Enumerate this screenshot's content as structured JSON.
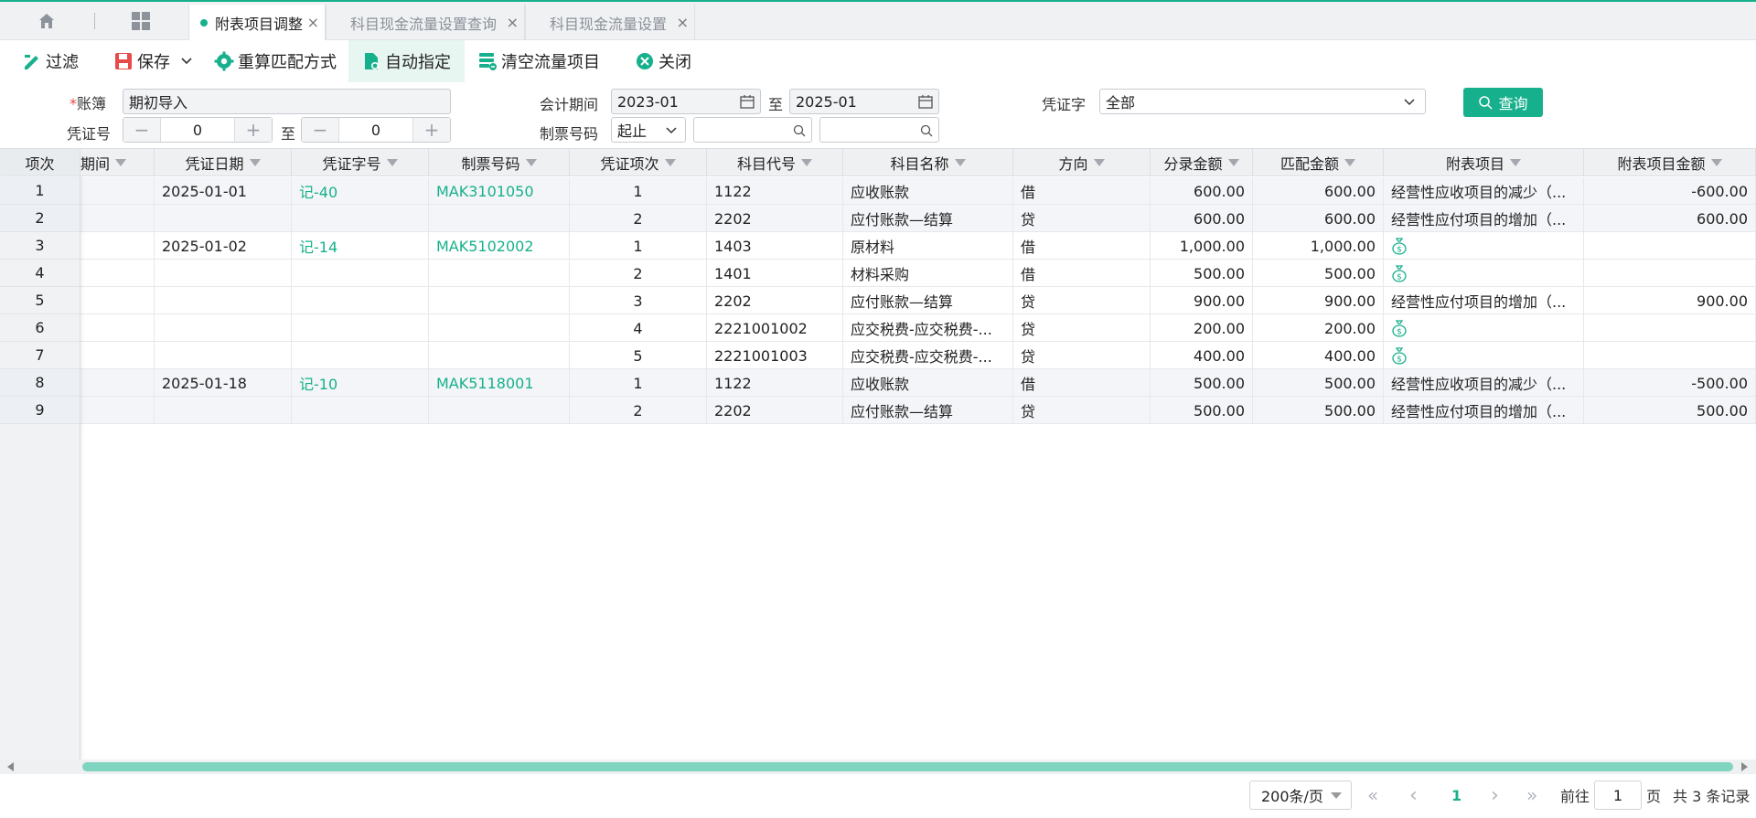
{
  "tabs": [
    {
      "label": "附表项目调整",
      "active": true
    },
    {
      "label": "科目现金流量设置查询",
      "active": false
    },
    {
      "label": "科目现金流量设置",
      "active": false
    }
  ],
  "toolbar": {
    "filter": "过滤",
    "save": "保存",
    "recalc": "重算匹配方式",
    "auto_assign": "自动指定",
    "clear_flow": "清空流量项目",
    "close": "关闭"
  },
  "filters": {
    "ledger_label": "账簿",
    "ledger_required_mark": "*",
    "ledger_value": "期初导入",
    "voucher_no_label": "凭证号",
    "voucher_no_from": "0",
    "voucher_no_to": "0",
    "to_label": "至",
    "period_label": "会计期间",
    "period_from": "2023-01",
    "period_to": "2025-01",
    "ticket_no_label": "制票号码",
    "ticket_mode": "起止",
    "ticket_from": "",
    "ticket_to": "",
    "voucher_word_label": "凭证字",
    "voucher_word_value": "全部",
    "query_button": "查询"
  },
  "grid": {
    "headers": [
      "项次",
      "期间",
      "凭证日期",
      "凭证字号",
      "制票号码",
      "凭证项次",
      "科目代号",
      "科目名称",
      "方向",
      "分录金额",
      "匹配金额",
      "附表项目",
      "附表项目金额"
    ],
    "rows": [
      {
        "idx": "1",
        "date": "2025-01-01",
        "word": "记-40",
        "ticket": "MAK3101050",
        "seq": "1",
        "code": "1122",
        "name": "应收账款",
        "dir": "借",
        "amount": "600.00",
        "match": "600.00",
        "item": "经营性应收项目的减少（...",
        "item_amount": "-600.00",
        "hl": true
      },
      {
        "idx": "2",
        "date": "",
        "word": "",
        "ticket": "",
        "seq": "2",
        "code": "2202",
        "name": "应付账款—结算",
        "dir": "贷",
        "amount": "600.00",
        "match": "600.00",
        "item": "经营性应付项目的增加（...",
        "item_amount": "600.00",
        "hl": true
      },
      {
        "idx": "3",
        "date": "2025-01-02",
        "word": "记-14",
        "ticket": "MAK5102002",
        "seq": "1",
        "code": "1403",
        "name": "原材料",
        "dir": "借",
        "amount": "1,000.00",
        "match": "1,000.00",
        "item": "",
        "item_amount": "",
        "hl": false
      },
      {
        "idx": "4",
        "date": "",
        "word": "",
        "ticket": "",
        "seq": "2",
        "code": "1401",
        "name": "材料采购",
        "dir": "借",
        "amount": "500.00",
        "match": "500.00",
        "item": "",
        "item_amount": "",
        "hl": false
      },
      {
        "idx": "5",
        "date": "",
        "word": "",
        "ticket": "",
        "seq": "3",
        "code": "2202",
        "name": "应付账款—结算",
        "dir": "贷",
        "amount": "900.00",
        "match": "900.00",
        "item": "经营性应付项目的增加（...",
        "item_amount": "900.00",
        "hl": false
      },
      {
        "idx": "6",
        "date": "",
        "word": "",
        "ticket": "",
        "seq": "4",
        "code": "2221001002",
        "name": "应交税费-应交税费-...",
        "dir": "贷",
        "amount": "200.00",
        "match": "200.00",
        "item": "",
        "item_amount": "",
        "hl": false
      },
      {
        "idx": "7",
        "date": "",
        "word": "",
        "ticket": "",
        "seq": "5",
        "code": "2221001003",
        "name": "应交税费-应交税费-...",
        "dir": "贷",
        "amount": "400.00",
        "match": "400.00",
        "item": "",
        "item_amount": "",
        "hl": false
      },
      {
        "idx": "8",
        "date": "2025-01-18",
        "word": "记-10",
        "ticket": "MAK5118001",
        "seq": "1",
        "code": "1122",
        "name": "应收账款",
        "dir": "借",
        "amount": "500.00",
        "match": "500.00",
        "item": "经营性应收项目的减少（...",
        "item_amount": "-500.00",
        "hl": true
      },
      {
        "idx": "9",
        "date": "",
        "word": "",
        "ticket": "",
        "seq": "2",
        "code": "2202",
        "name": "应付账款—结算",
        "dir": "贷",
        "amount": "500.00",
        "match": "500.00",
        "item": "经营性应付项目的增加（...",
        "item_amount": "500.00",
        "hl": true
      }
    ]
  },
  "pager": {
    "page_size": "200条/页",
    "current_page": "1",
    "goto_label": "前往",
    "goto_value": "1",
    "page_unit": "页",
    "total": "共 3 条记录"
  },
  "colors": {
    "accent": "#17b08c",
    "save_icon": "#e84a4a",
    "close_icon": "#17b08c"
  }
}
